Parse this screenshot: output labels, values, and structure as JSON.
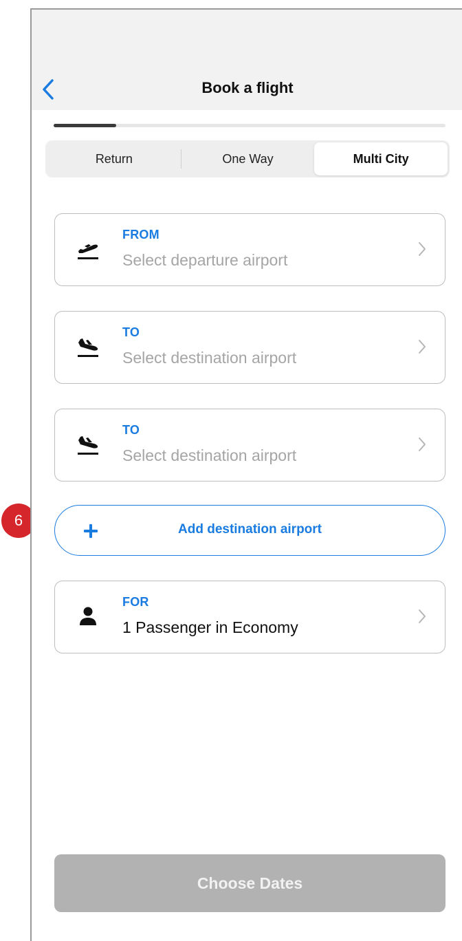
{
  "header": {
    "title": "Book a flight",
    "back_icon": "chevron-left-icon"
  },
  "progress": {
    "value": 0.16
  },
  "trip_types": {
    "options": [
      "Return",
      "One Way",
      "Multi City"
    ],
    "selected": "Multi City"
  },
  "fields": [
    {
      "label": "FROM",
      "value": "Select departure airport",
      "icon": "plane-departure-icon",
      "placeholder": true
    },
    {
      "label": "TO",
      "value": "Select destination airport",
      "icon": "plane-arrival-icon",
      "placeholder": true
    },
    {
      "label": "TO",
      "value": "Select destination airport",
      "icon": "plane-arrival-icon",
      "placeholder": true
    }
  ],
  "add_destination": {
    "label": "Add destination airport",
    "icon": "plus-icon"
  },
  "passengers": {
    "label": "FOR",
    "value": "1 Passenger in Economy",
    "icon": "person-icon"
  },
  "badge": {
    "text": "6"
  },
  "cta": {
    "label": "Choose Dates",
    "enabled": false
  },
  "colors": {
    "accent": "#1a7be0",
    "badge": "#d4262b",
    "disabled_button": "#b2b2b2",
    "placeholder_text": "#a5a5a5"
  }
}
